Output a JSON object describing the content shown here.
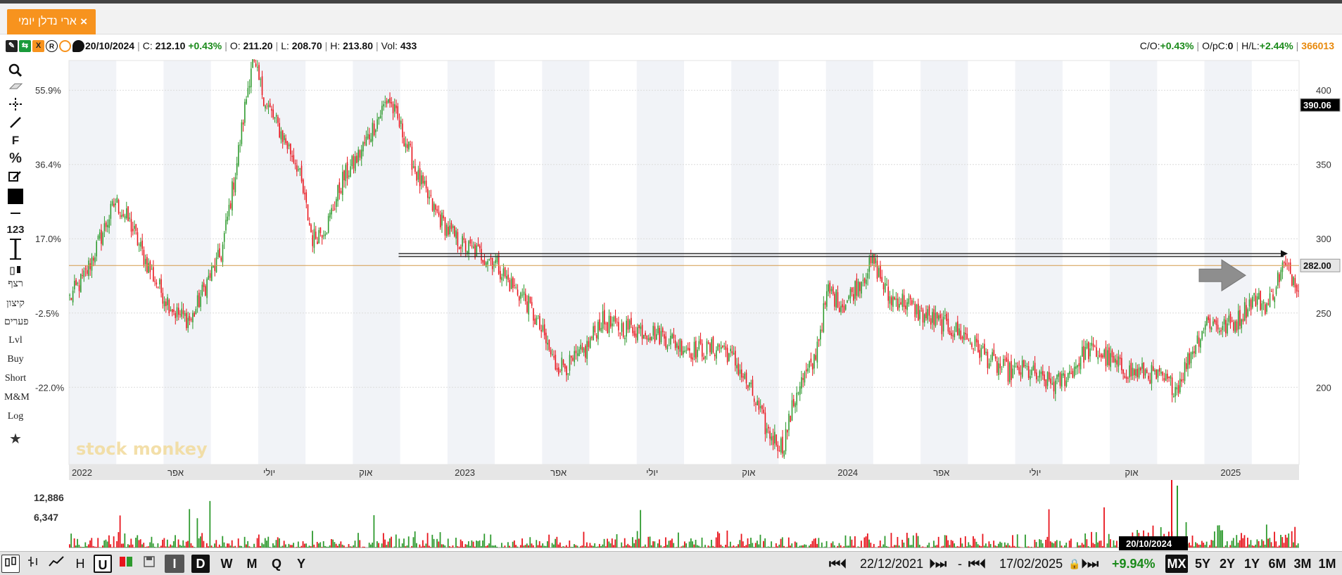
{
  "tab": {
    "title": "ארי נדלן יומי",
    "close": "×"
  },
  "infobar": {
    "date": "20/10/2024",
    "close_label": "C:",
    "close_value": "212.10",
    "change": "+0.43%",
    "open_label": "O:",
    "open_value": "211.20",
    "low_label": "L:",
    "low_value": "208.70",
    "high_label": "H:",
    "high_value": "213.80",
    "vol_label": "Vol:",
    "vol_value": "433",
    "co_label": "C/O:",
    "co_value": "+0.43%",
    "opc_label": "O/pC:",
    "opc_value": "0",
    "hl_label": "H/L:",
    "hl_value": "+2.44%",
    "security_id": "366013"
  },
  "toolbar": {
    "items": [
      "search",
      "eraser",
      "crosshair",
      "line",
      "F",
      "%",
      "edit",
      "color",
      "—",
      "123",
      "measure",
      "candle"
    ],
    "text_items": [
      "רצף",
      "קיצון",
      "פערים",
      "Lvl",
      "Buy",
      "Short",
      "M&M",
      "Log"
    ]
  },
  "chart_data": {
    "type": "candlestick",
    "x_labels": [
      "2022",
      "אפר",
      "יולי",
      "אוק",
      "2023",
      "אפר",
      "יולי",
      "אוק",
      "2024",
      "אפר",
      "יולי",
      "אוק",
      "2025"
    ],
    "y_ticks_right": [
      "400",
      "350",
      "300",
      "250",
      "200"
    ],
    "y_ticks_left": [
      "55.9%",
      "36.4%",
      "17.0%",
      "-2.5%",
      "-22.0%"
    ],
    "ylim": [
      148,
      420
    ],
    "price_tags": [
      "390.06",
      "282.00"
    ],
    "horizontal_levels": [
      282,
      288,
      290
    ],
    "volume_ticks": [
      "12,886",
      "6,347"
    ],
    "date_tag": "20/10/2024",
    "watermark": "stock monkey",
    "series": [
      {
        "values": [
          260,
          275,
          300,
          325,
          310,
          285,
          265,
          250,
          245,
          270,
          290,
          350,
          420,
          390,
          370,
          350,
          300,
          310,
          340,
          355,
          375,
          395,
          370,
          340,
          320,
          305,
          295,
          290,
          285,
          270,
          260,
          240,
          215,
          215,
          225,
          245,
          240,
          240,
          238,
          235,
          230,
          225,
          225,
          228,
          215,
          195,
          170,
          160,
          200,
          215,
          265,
          255,
          270,
          285,
          260,
          258,
          250,
          245,
          240,
          235,
          225,
          215,
          210,
          212,
          205,
          202,
          210,
          225,
          222,
          215,
          210,
          210,
          205,
          200,
          225,
          245,
          240,
          245,
          260,
          255,
          282,
          270
        ]
      }
    ]
  },
  "bottombar": {
    "left_buttons": [
      "candles",
      "bars",
      "line",
      "H",
      "U",
      "colors",
      "save"
    ],
    "periods": [
      "I",
      "D",
      "W",
      "M",
      "Q",
      "Y"
    ],
    "active_period": "D",
    "start_date": "22/12/2021",
    "dash": "-",
    "end_date": "17/02/2025",
    "change": "+9.94%",
    "ranges": [
      "MX",
      "5Y",
      "2Y",
      "1Y",
      "6M",
      "3M",
      "1M"
    ],
    "active_range": "MX"
  },
  "colors": {
    "accent": "#f7931e",
    "up": "#2e9a2e",
    "down": "#e8141c",
    "grid_band": "#f1f3f7"
  }
}
